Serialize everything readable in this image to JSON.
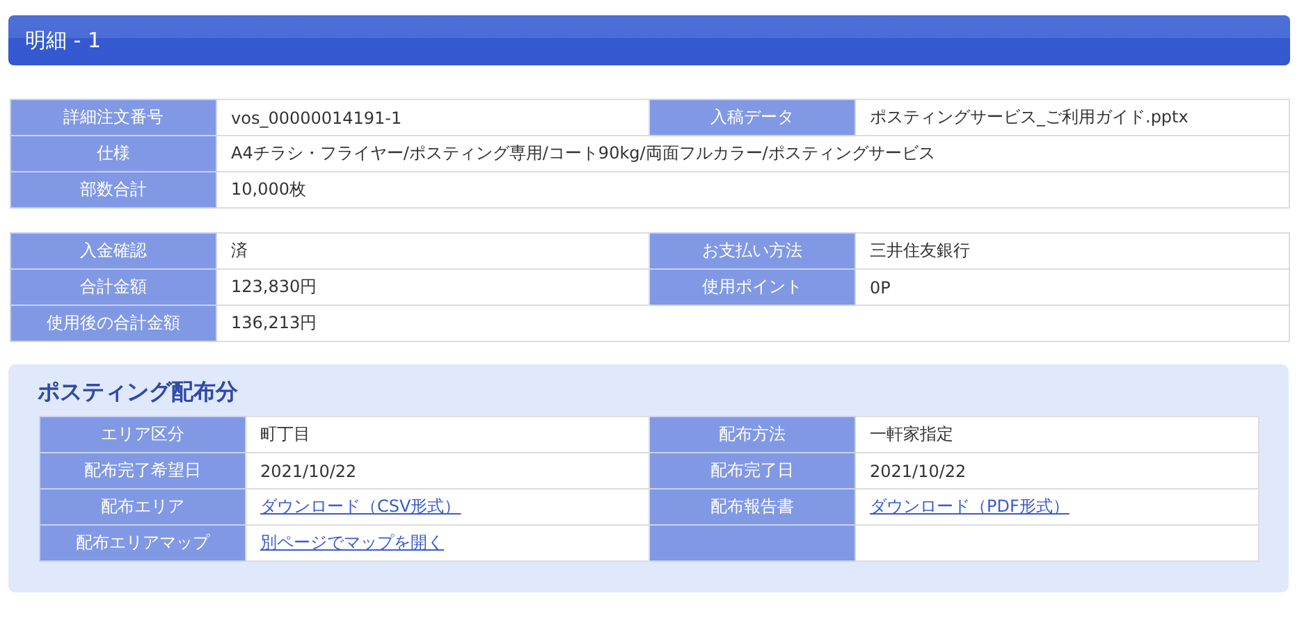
{
  "header": {
    "title": "明細 - 1"
  },
  "tables": [
    {
      "rows": [
        {
          "cells": [
            {
              "kind": "label",
              "text": "詳細注文番号"
            },
            {
              "kind": "value",
              "text": "vos_00000014191-1"
            },
            {
              "kind": "label",
              "text": "入稿データ"
            },
            {
              "kind": "value",
              "text": "ポスティングサービス_ご利用ガイド.pptx"
            }
          ]
        },
        {
          "cells": [
            {
              "kind": "label",
              "text": "仕様"
            },
            {
              "kind": "value",
              "text": "A4チラシ・フライヤー/ポスティング専用/コート90kg/両面フルカラー/ポスティングサービス",
              "colspan": 3
            }
          ]
        },
        {
          "cells": [
            {
              "kind": "label",
              "text": "部数合計"
            },
            {
              "kind": "value",
              "text": "10,000枚",
              "colspan": 3
            }
          ]
        }
      ]
    },
    {
      "rows": [
        {
          "cells": [
            {
              "kind": "label",
              "text": "入金確認"
            },
            {
              "kind": "value",
              "text": "済"
            },
            {
              "kind": "label",
              "text": "お支払い方法"
            },
            {
              "kind": "value",
              "text": "三井住友銀行"
            }
          ]
        },
        {
          "cells": [
            {
              "kind": "label",
              "text": "合計金額"
            },
            {
              "kind": "value",
              "text": "123,830円"
            },
            {
              "kind": "label",
              "text": "使用ポイント"
            },
            {
              "kind": "value",
              "text": "0P"
            }
          ]
        },
        {
          "cells": [
            {
              "kind": "label",
              "text": "使用後の合計金額"
            },
            {
              "kind": "value",
              "text": "136,213円",
              "colspan": 3
            }
          ]
        }
      ]
    }
  ],
  "posting": {
    "title": "ポスティング配布分",
    "rows": [
      {
        "cells": [
          {
            "kind": "label",
            "text": "エリア区分"
          },
          {
            "kind": "value",
            "text": "町丁目"
          },
          {
            "kind": "label",
            "text": "配布方法"
          },
          {
            "kind": "value",
            "text": "一軒家指定"
          }
        ]
      },
      {
        "cells": [
          {
            "kind": "label",
            "text": "配布完了希望日"
          },
          {
            "kind": "value",
            "text": "2021/10/22"
          },
          {
            "kind": "label",
            "text": "配布完了日"
          },
          {
            "kind": "value",
            "text": "2021/10/22"
          }
        ]
      },
      {
        "cells": [
          {
            "kind": "label",
            "text": "配布エリア"
          },
          {
            "kind": "link",
            "text": "ダウンロード（CSV形式）"
          },
          {
            "kind": "label",
            "text": "配布報告書"
          },
          {
            "kind": "link",
            "text": "ダウンロード（PDF形式）"
          }
        ]
      },
      {
        "cells": [
          {
            "kind": "label",
            "text": "配布エリアマップ"
          },
          {
            "kind": "link",
            "text": "別ページでマップを開く"
          },
          {
            "kind": "label"
          },
          {
            "kind": "value"
          }
        ]
      }
    ]
  }
}
